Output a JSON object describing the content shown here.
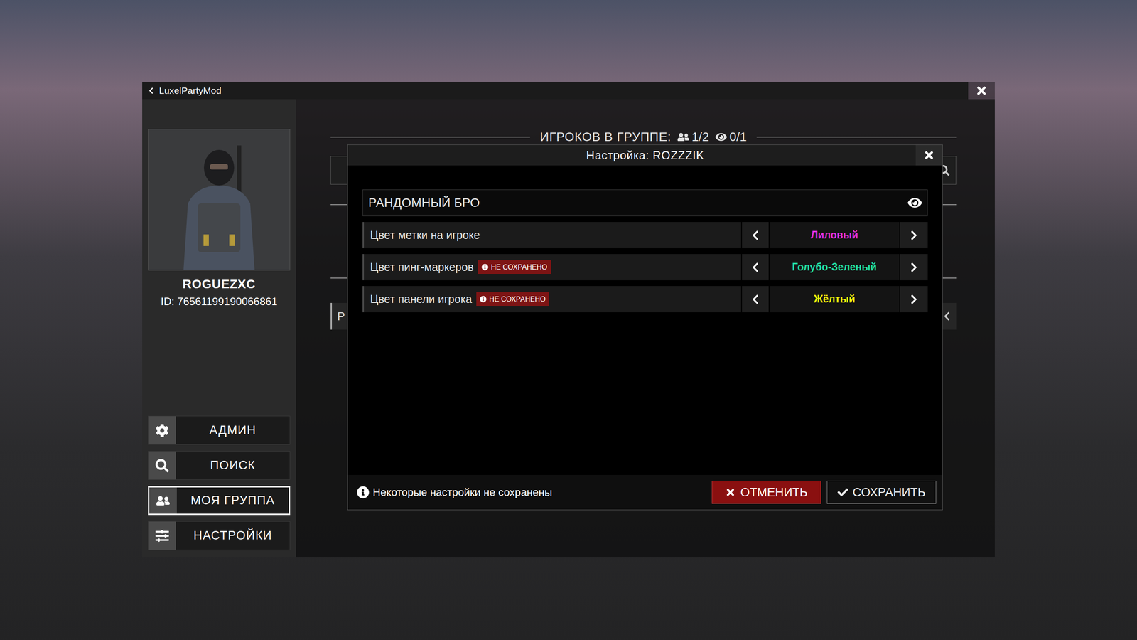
{
  "window": {
    "title": "LuxelPartyMod"
  },
  "profile": {
    "name": "ROGUEZXC",
    "id_label": "ID:",
    "id": "76561199190066861"
  },
  "menu": [
    {
      "label": "АДМИН",
      "selected": false
    },
    {
      "label": "ПОИСК",
      "selected": false
    },
    {
      "label": "МОЯ ГРУППА",
      "selected": true
    },
    {
      "label": "НАСТРОЙКИ",
      "selected": false
    }
  ],
  "group": {
    "heading": "ИГРОКОВ В ГРУППЕ:",
    "members": "1/2",
    "spectators": "0/1",
    "row_text": "Р"
  },
  "dialog": {
    "title": "Настройка: ROZZZIK",
    "nickname": "РАНДОМНЫЙ БРО",
    "unsaved_badge": "НЕ СОХРАНЕНО",
    "settings": [
      {
        "label": "Цвет метки на игроке",
        "value": "Лиловый",
        "color": "#e22fe2",
        "saved": true
      },
      {
        "label": "Цвет пинг-маркеров",
        "value": "Голубо-Зеленый",
        "color": "#22e0a4",
        "saved": false
      },
      {
        "label": "Цвет панели игрока",
        "value": "Жёлтый",
        "color": "#f2f20a",
        "saved": false
      }
    ],
    "footer_note": "Некоторые настройки не сохранены",
    "buttons": [
      {
        "label": "ОТМЕНИТЬ",
        "kind": "cancel"
      },
      {
        "label": "СОХРАНИТЬ",
        "kind": "save"
      }
    ]
  }
}
